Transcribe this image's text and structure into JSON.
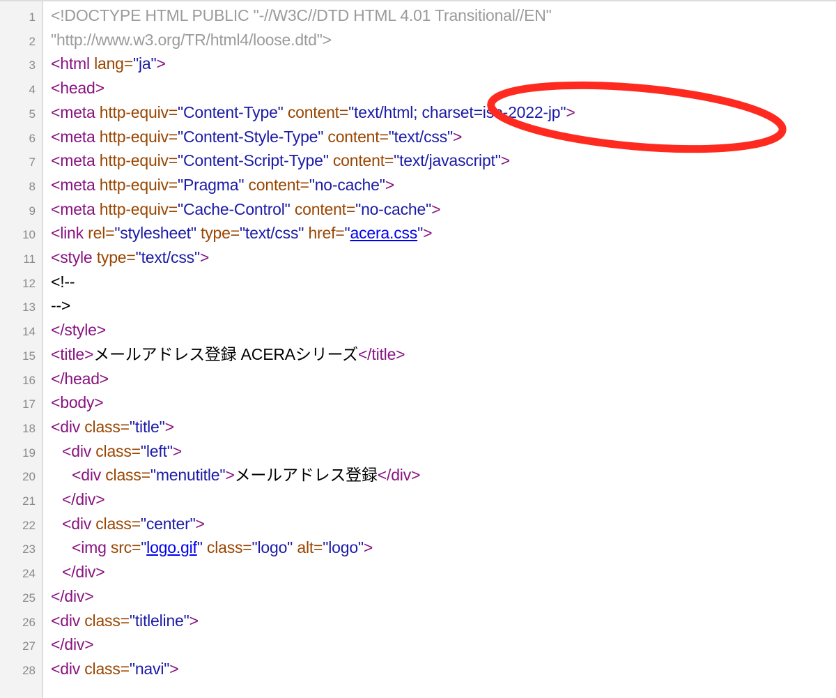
{
  "lines": [
    {
      "num": "1",
      "parts": [
        {
          "t": "<!DOCTYPE HTML PUBLIC \"-//W3C//DTD HTML 4.01 Transitional//EN\"",
          "c": "doctype"
        }
      ]
    },
    {
      "num": "2",
      "parts": [
        {
          "t": "\"http://www.w3.org/TR/html4/loose.dtd\">",
          "c": "doctype"
        }
      ]
    },
    {
      "num": "3",
      "parts": [
        {
          "t": "<html ",
          "c": "tag"
        },
        {
          "t": "lang=",
          "c": "attr"
        },
        {
          "t": "\"ja\"",
          "c": "val"
        },
        {
          "t": ">",
          "c": "tag"
        }
      ]
    },
    {
      "num": "4",
      "parts": [
        {
          "t": "<head>",
          "c": "tag"
        }
      ]
    },
    {
      "num": "5",
      "parts": [
        {
          "t": "<meta ",
          "c": "tag"
        },
        {
          "t": "http-equiv=",
          "c": "attr"
        },
        {
          "t": "\"Content-Type\"",
          "c": "val"
        },
        {
          "t": " content=",
          "c": "attr"
        },
        {
          "t": "\"text/html; charset=iso-2022-jp\"",
          "c": "val"
        },
        {
          "t": ">",
          "c": "tag"
        }
      ]
    },
    {
      "num": "6",
      "parts": [
        {
          "t": "<meta ",
          "c": "tag"
        },
        {
          "t": "http-equiv=",
          "c": "attr"
        },
        {
          "t": "\"Content-Style-Type\"",
          "c": "val"
        },
        {
          "t": " content=",
          "c": "attr"
        },
        {
          "t": "\"text/css\"",
          "c": "val"
        },
        {
          "t": ">",
          "c": "tag"
        }
      ]
    },
    {
      "num": "7",
      "parts": [
        {
          "t": "<meta ",
          "c": "tag"
        },
        {
          "t": "http-equiv=",
          "c": "attr"
        },
        {
          "t": "\"Content-Script-Type\"",
          "c": "val"
        },
        {
          "t": " content=",
          "c": "attr"
        },
        {
          "t": "\"text/javascript\"",
          "c": "val"
        },
        {
          "t": ">",
          "c": "tag"
        }
      ]
    },
    {
      "num": "8",
      "parts": [
        {
          "t": "<meta ",
          "c": "tag"
        },
        {
          "t": "http-equiv=",
          "c": "attr"
        },
        {
          "t": "\"Pragma\"",
          "c": "val"
        },
        {
          "t": " content=",
          "c": "attr"
        },
        {
          "t": "\"no-cache\"",
          "c": "val"
        },
        {
          "t": ">",
          "c": "tag"
        }
      ]
    },
    {
      "num": "9",
      "parts": [
        {
          "t": "<meta ",
          "c": "tag"
        },
        {
          "t": "http-equiv=",
          "c": "attr"
        },
        {
          "t": "\"Cache-Control\"",
          "c": "val"
        },
        {
          "t": " content=",
          "c": "attr"
        },
        {
          "t": "\"no-cache\"",
          "c": "val"
        },
        {
          "t": ">",
          "c": "tag"
        }
      ]
    },
    {
      "num": "10",
      "parts": [
        {
          "t": "<link ",
          "c": "tag"
        },
        {
          "t": "rel=",
          "c": "attr"
        },
        {
          "t": "\"stylesheet\"",
          "c": "val"
        },
        {
          "t": " type=",
          "c": "attr"
        },
        {
          "t": "\"text/css\"",
          "c": "val"
        },
        {
          "t": " href=",
          "c": "attr"
        },
        {
          "t": "\"",
          "c": "val"
        },
        {
          "t": "acera.css",
          "c": "link"
        },
        {
          "t": "\"",
          "c": "val"
        },
        {
          "t": ">",
          "c": "tag"
        }
      ]
    },
    {
      "num": "11",
      "parts": [
        {
          "t": "<style ",
          "c": "tag"
        },
        {
          "t": "type=",
          "c": "attr"
        },
        {
          "t": "\"text/css\"",
          "c": "val"
        },
        {
          "t": ">",
          "c": "tag"
        }
      ]
    },
    {
      "num": "12",
      "parts": [
        {
          "t": "<!--",
          "c": "txt"
        }
      ]
    },
    {
      "num": "13",
      "parts": [
        {
          "t": "-->",
          "c": "txt"
        }
      ]
    },
    {
      "num": "14",
      "parts": [
        {
          "t": "</style>",
          "c": "tag"
        }
      ]
    },
    {
      "num": "15",
      "parts": [
        {
          "t": "<title>",
          "c": "tag"
        },
        {
          "t": "メールアドレス登録 ACERAシリーズ",
          "c": "txt"
        },
        {
          "t": "</title>",
          "c": "tag"
        }
      ]
    },
    {
      "num": "16",
      "parts": [
        {
          "t": "</head>",
          "c": "tag"
        }
      ]
    },
    {
      "num": "17",
      "parts": [
        {
          "t": "<body>",
          "c": "tag"
        }
      ]
    },
    {
      "num": "18",
      "parts": [
        {
          "t": "<div ",
          "c": "tag"
        },
        {
          "t": "class=",
          "c": "attr"
        },
        {
          "t": "\"title\"",
          "c": "val"
        },
        {
          "t": ">",
          "c": "tag"
        }
      ]
    },
    {
      "num": "19",
      "indent": 1,
      "parts": [
        {
          "t": "<div ",
          "c": "tag"
        },
        {
          "t": "class=",
          "c": "attr"
        },
        {
          "t": "\"left\"",
          "c": "val"
        },
        {
          "t": ">",
          "c": "tag"
        }
      ]
    },
    {
      "num": "20",
      "indent": 2,
      "parts": [
        {
          "t": "<div ",
          "c": "tag"
        },
        {
          "t": "class=",
          "c": "attr"
        },
        {
          "t": "\"menutitle\"",
          "c": "val"
        },
        {
          "t": ">",
          "c": "tag"
        },
        {
          "t": "メールアドレス登録",
          "c": "txt"
        },
        {
          "t": "</div>",
          "c": "tag"
        }
      ]
    },
    {
      "num": "21",
      "indent": 1,
      "parts": [
        {
          "t": "</div>",
          "c": "tag"
        }
      ]
    },
    {
      "num": "22",
      "indent": 1,
      "parts": [
        {
          "t": "<div ",
          "c": "tag"
        },
        {
          "t": "class=",
          "c": "attr"
        },
        {
          "t": "\"center\"",
          "c": "val"
        },
        {
          "t": ">",
          "c": "tag"
        }
      ]
    },
    {
      "num": "23",
      "indent": 2,
      "parts": [
        {
          "t": "<img ",
          "c": "tag"
        },
        {
          "t": "src=",
          "c": "attr"
        },
        {
          "t": "\"",
          "c": "val"
        },
        {
          "t": "logo.gif",
          "c": "link"
        },
        {
          "t": "\"",
          "c": "val"
        },
        {
          "t": " class=",
          "c": "attr"
        },
        {
          "t": "\"logo\"",
          "c": "val"
        },
        {
          "t": " alt=",
          "c": "attr"
        },
        {
          "t": "\"logo\"",
          "c": "val"
        },
        {
          "t": ">",
          "c": "tag"
        }
      ]
    },
    {
      "num": "24",
      "indent": 1,
      "parts": [
        {
          "t": "</div>",
          "c": "tag"
        }
      ]
    },
    {
      "num": "25",
      "parts": [
        {
          "t": "</div>",
          "c": "tag"
        }
      ]
    },
    {
      "num": "26",
      "parts": [
        {
          "t": "<div ",
          "c": "tag"
        },
        {
          "t": "class=",
          "c": "attr"
        },
        {
          "t": "\"titleline\"",
          "c": "val"
        },
        {
          "t": ">",
          "c": "tag"
        }
      ]
    },
    {
      "num": "27",
      "parts": [
        {
          "t": "</div>",
          "c": "tag"
        }
      ]
    },
    {
      "num": "28",
      "parts": [
        {
          "t": "<div ",
          "c": "tag"
        },
        {
          "t": "class=",
          "c": "attr"
        },
        {
          "t": "\"navi\"",
          "c": "val"
        },
        {
          "t": ">",
          "c": "tag"
        }
      ]
    }
  ],
  "colors": {
    "tag": "#881280",
    "attr": "#994500",
    "val": "#1a1aa6",
    "doctype": "#9b9b9b",
    "link": "#0000ee",
    "highlight": "#ff2a1f"
  },
  "annotation": {
    "shape": "ellipse",
    "color": "#ff2a1f",
    "target": "charset=iso-2022-jp"
  }
}
